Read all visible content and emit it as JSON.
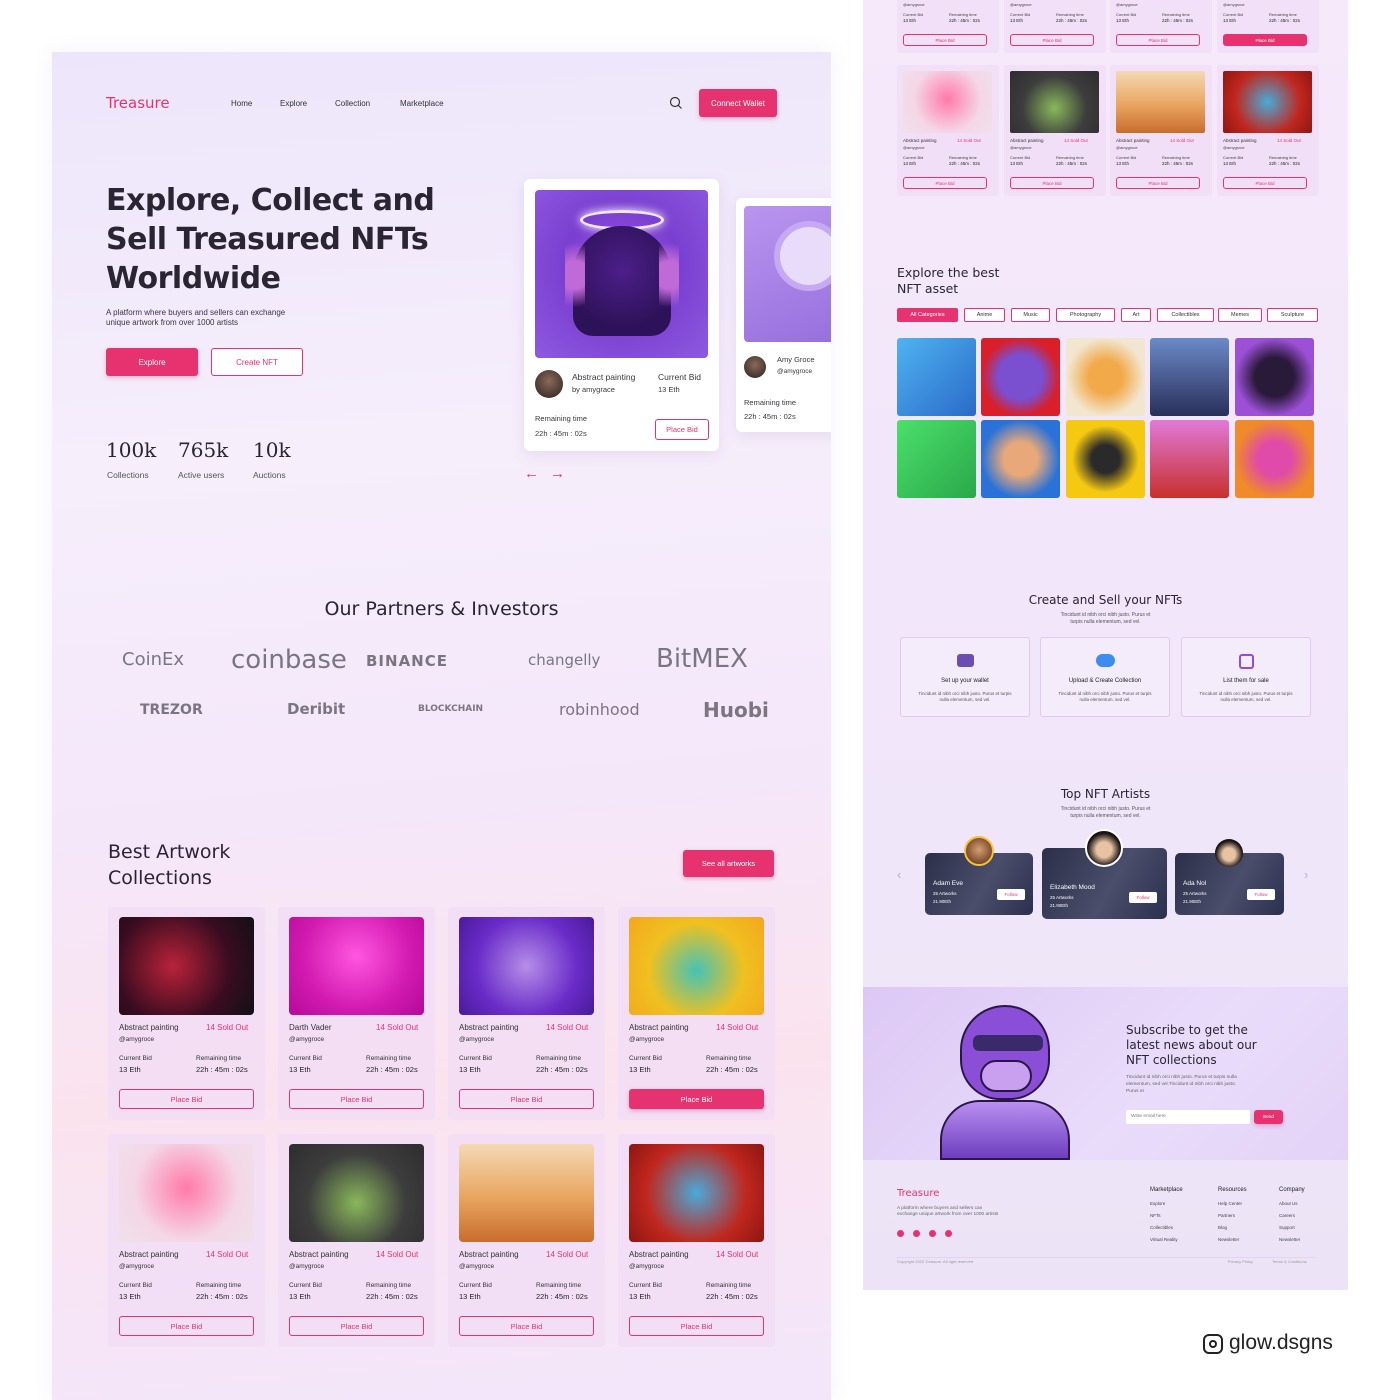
{
  "brand": "Treasure",
  "nav": {
    "home": "Home",
    "explore": "Explore",
    "collection": "Collection",
    "marketplace": "Marketplace",
    "connect": "Connect Wallet"
  },
  "hero": {
    "title_l1": "Explore, Collect and",
    "title_l2": "Sell Treasured NFTs",
    "title_l3": "Worldwide",
    "desc_l1": "A platform where buyers and sellers can exchange",
    "desc_l2": "unique artwork from over 1000 artists",
    "explore_btn": "Explore",
    "create_btn": "Create NFT"
  },
  "stats": [
    {
      "num": "100k",
      "label": "Collections"
    },
    {
      "num": "765k",
      "label": "Active users"
    },
    {
      "num": "10k",
      "label": "Auctions"
    }
  ],
  "featured": {
    "name": "Abstract painting",
    "by": "by amygrace",
    "bid_label": "Current Bid",
    "bid": "13 Eth",
    "remaining_label": "Remaining time",
    "remaining": "22h : 45m : 02s",
    "place_bid": "Place Bid",
    "second_name": "Amy Groce",
    "second_handle": "@amygroce",
    "second_remaining_label": "Remaining time",
    "second_remaining": "22h : 45m : 02s"
  },
  "partners": {
    "title": "Our Partners & Investors",
    "row1": [
      "CoinEx",
      "coinbase",
      "BINANCE",
      "changelly",
      "BitMEX"
    ],
    "row2": [
      "TREZOR",
      "Deribit",
      "BLOCKCHAIN",
      "robinhood",
      "Huobi"
    ]
  },
  "collections": {
    "title_l1": "Best Artwork",
    "title_l2": "Collections",
    "see_all": "See all artworks",
    "items": [
      {
        "name": "Abstract painting",
        "handle": "@amygroce",
        "sold": "14 Sold Out",
        "bid_label": "Current Bid",
        "bid": "13 Eth",
        "rem_label": "Remaining time",
        "rem": "22h : 45m : 02s",
        "btn": "Place Bid"
      },
      {
        "name": "Darth Vader",
        "handle": "@amygroce",
        "sold": "14 Sold Out",
        "bid_label": "Current Bid",
        "bid": "13 Eth",
        "rem_label": "Remaining time",
        "rem": "22h : 45m : 02s",
        "btn": "Place Bid"
      },
      {
        "name": "Abstract painting",
        "handle": "@amygroce",
        "sold": "14 Sold Out",
        "bid_label": "Current Bid",
        "bid": "13 Eth",
        "rem_label": "Remaining time",
        "rem": "22h : 45m : 02s",
        "btn": "Place Bid"
      },
      {
        "name": "Abstract painting",
        "handle": "@amygroce",
        "sold": "14 Sold Out",
        "bid_label": "Current Bid",
        "bid": "13 Eth",
        "rem_label": "Remaining time",
        "rem": "22h : 45m : 02s",
        "btn": "Place Bid"
      },
      {
        "name": "Abstract painting",
        "handle": "@amygroce",
        "sold": "14 Sold Out",
        "bid_label": "Current Bid",
        "bid": "13 Eth",
        "rem_label": "Remaining time",
        "rem": "22h : 45m : 02s",
        "btn": "Place Bid"
      },
      {
        "name": "Abstract painting",
        "handle": "@amygroce",
        "sold": "14 Sold Out",
        "bid_label": "Current Bid",
        "bid": "13 Eth",
        "rem_label": "Remaining time",
        "rem": "22h : 45m : 02s",
        "btn": "Place Bid"
      },
      {
        "name": "Abstract painting",
        "handle": "@amygroce",
        "sold": "14 Sold Out",
        "bid_label": "Current Bid",
        "bid": "13 Eth",
        "rem_label": "Remaining time",
        "rem": "22h : 45m : 02s",
        "btn": "Place Bid"
      },
      {
        "name": "Abstract painting",
        "handle": "@amygroce",
        "sold": "14 Sold Out",
        "bid_label": "Current Bid",
        "bid": "13 Eth",
        "rem_label": "Remaining time",
        "rem": "22h : 45m : 02s",
        "btn": "Place Bid"
      }
    ]
  },
  "explore": {
    "title_l1": "Explore the best",
    "title_l2": "NFT asset",
    "cats": [
      "All Categories",
      "Anime",
      "Music",
      "Photography",
      "Art",
      "Collectibles",
      "Memes",
      "Sculpture"
    ]
  },
  "create": {
    "title": "Create and Sell your NFTs",
    "sub_l1": "Tincidunt id nibh orci nibh justo. Purus et",
    "sub_l2": "turpis nulla elementum, sed vel.",
    "steps": [
      {
        "title": "Set up your wallet",
        "d1": "Tincidunt id nibh orci nibh justo. Purus et turpis",
        "d2": "nulla elementum, sed vel."
      },
      {
        "title": "Upload & Create Collection",
        "d1": "Tincidunt id nibh orci nibh justo. Purus et turpis",
        "d2": "nulla elementum, sed vel."
      },
      {
        "title": "List them for sale",
        "d1": "Tincidunt id nibh orci nibh justo. Purus et turpis",
        "d2": "nulla elementum, sed vel."
      }
    ]
  },
  "artists": {
    "title": "Top NFT Artists",
    "sub_l1": "Tincidunt id nibh orci nibh justo. Purus et",
    "sub_l2": "turpis nulla elementum, sed vel.",
    "items": [
      {
        "name": "Adam Eve",
        "works": "25 Artworks",
        "eth": "21.90Eth",
        "follow": "Follow"
      },
      {
        "name": "Elizabeth Mood",
        "works": "25 Artworks",
        "eth": "21.90Eth",
        "follow": "Follow"
      },
      {
        "name": "Ada Nol",
        "works": "25 Artworks",
        "eth": "21.90Eth",
        "follow": "Follow"
      }
    ]
  },
  "subscribe": {
    "t1": "Subscribe to get the",
    "t2": "latest news about our",
    "t3": "NFT collections",
    "d1": "Tincidunt id nibh orci nibh justo. Purus et turpis nulla",
    "d2": "elementum, sed vel.Tincidunt id nibh orci nibh justo.",
    "d3": "Purus et",
    "placeholder": "Write email here",
    "send": "Send"
  },
  "footer": {
    "brand": "Treasure",
    "d1": "A platform where buyers and sellers can",
    "d2": "exchange unique artwork from over 1000 artists",
    "col1": {
      "title": "Marketplace",
      "links": [
        "Explore",
        "NFTs",
        "Collectibles",
        "Virtual Reality"
      ]
    },
    "col2": {
      "title": "Resources",
      "links": [
        "Help Center",
        "Partners",
        "Blog",
        "Newsletter"
      ]
    },
    "col3": {
      "title": "Company",
      "links": [
        "About Us",
        "Careers",
        "Support",
        "Newsletter"
      ]
    },
    "copyright": "Copyright 2022 Treasure. All right reserved",
    "privacy": "Privacy Policy",
    "terms": "Terms & Conditions"
  },
  "mini": {
    "name": "Abstract painting",
    "sold": "14 Sold Out",
    "handle": "@amygroce",
    "bid_label": "Current Bid",
    "bid": "13 Eth",
    "rem_label": "Remaining time",
    "rem": "22h : 45m : 02s",
    "btn": "Place Bid"
  },
  "watermark": "glow.dsgns",
  "colors": {
    "accent": "#e6336f",
    "text": "#2a2433",
    "bg": "#f3e8fb"
  }
}
